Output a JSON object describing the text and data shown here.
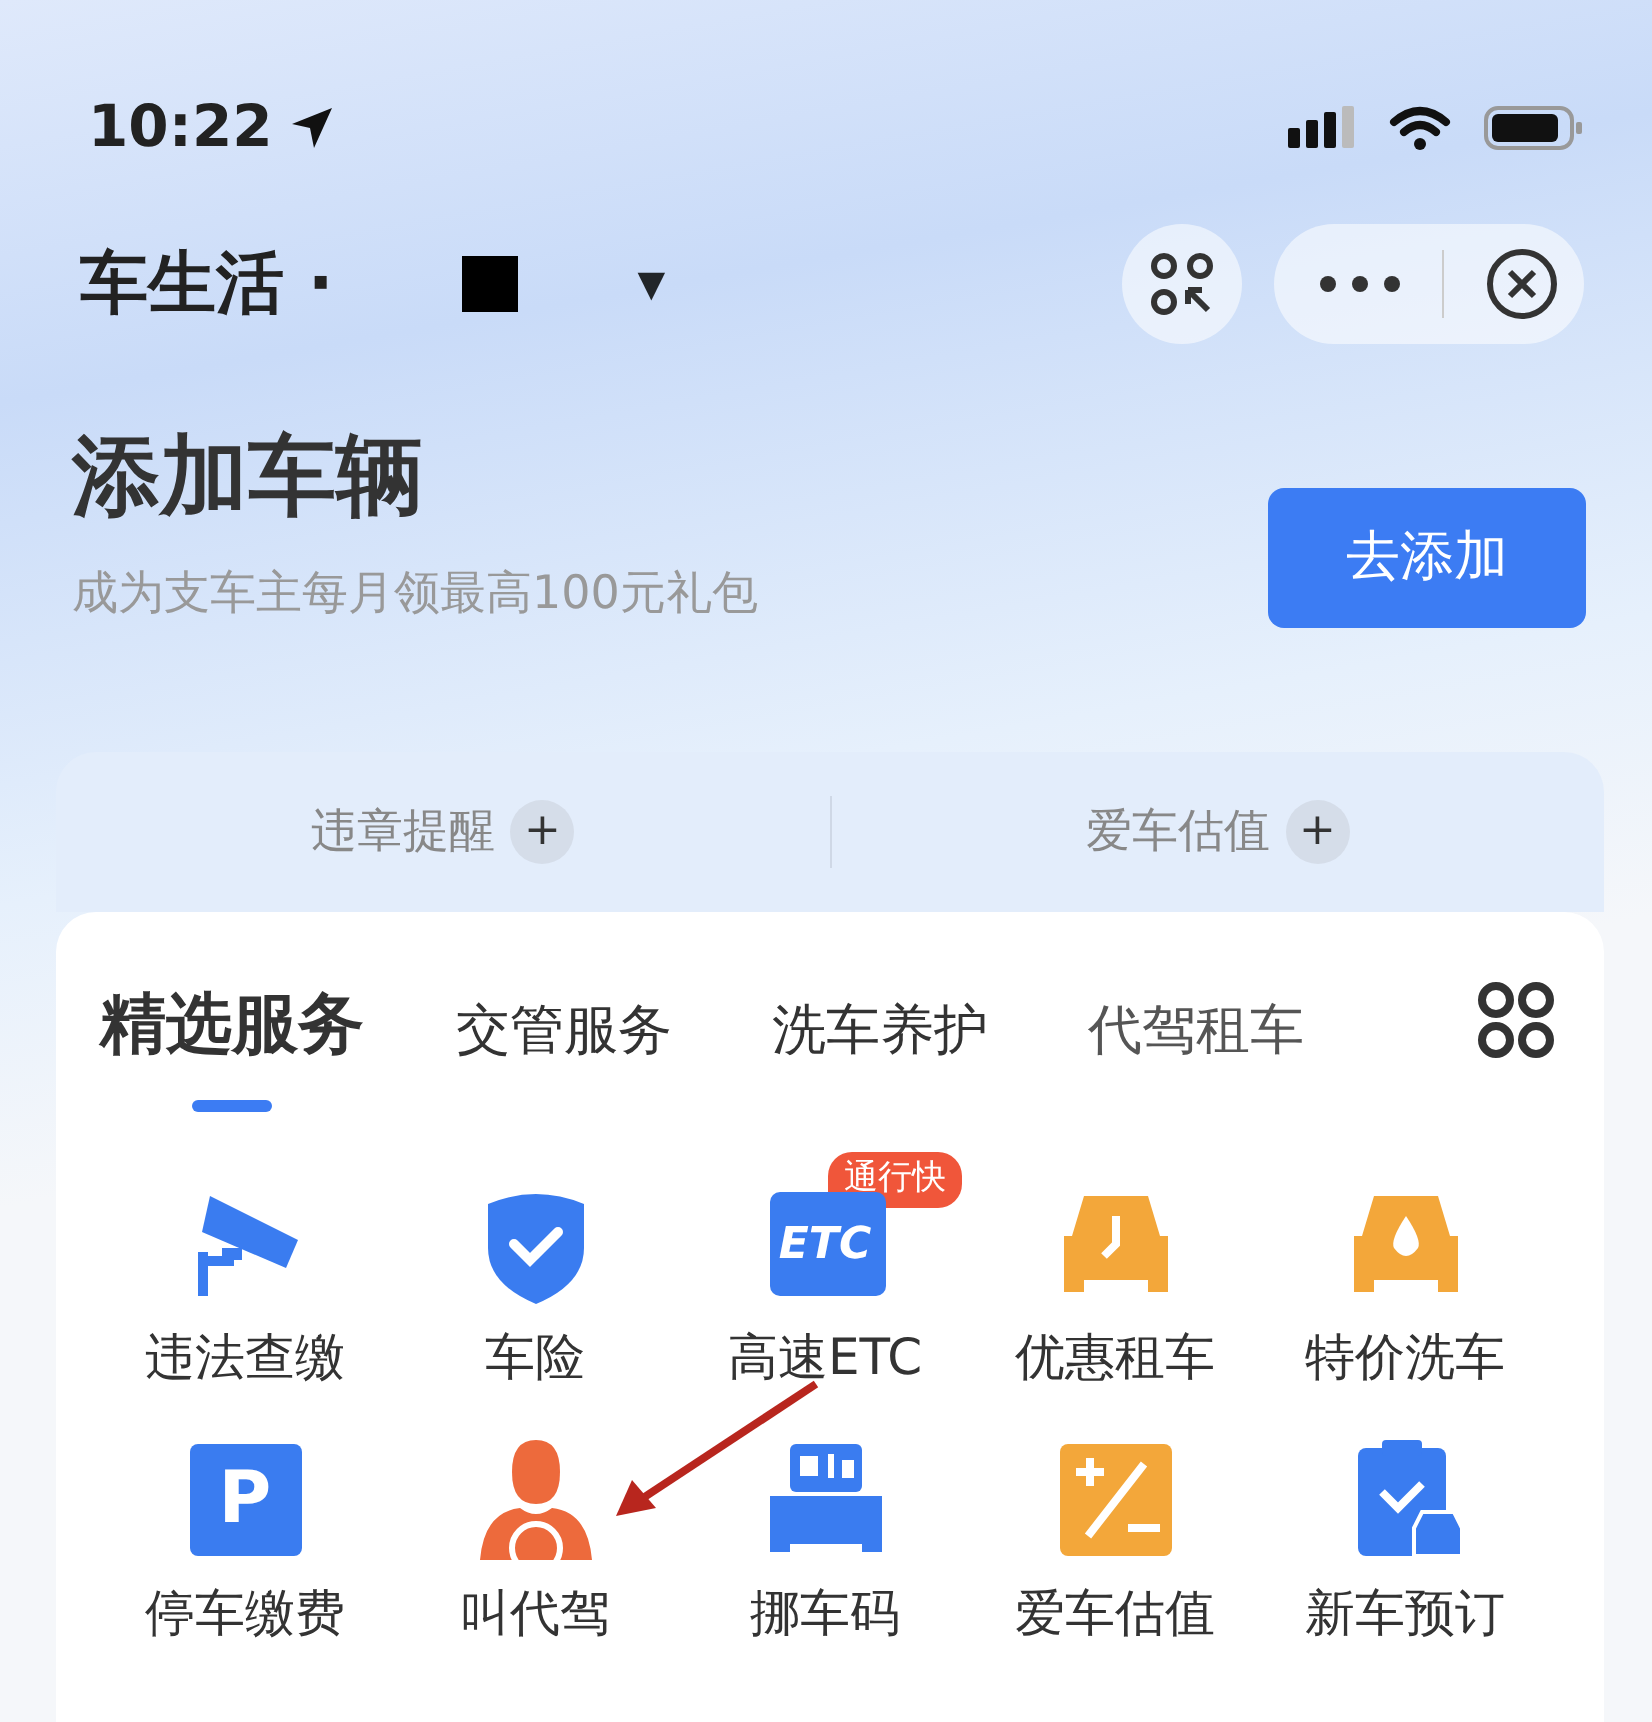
{
  "status_bar": {
    "time": "10:22"
  },
  "header": {
    "title": "车生活 ·",
    "dropdown_caret": "▼"
  },
  "hero": {
    "title": "添加车辆",
    "subtitle": "成为支车主每月领最高100元礼包",
    "button": "去添加"
  },
  "quick_links": [
    {
      "label": "违章提醒",
      "plus": "+"
    },
    {
      "label": "爱车估值",
      "plus": "+"
    }
  ],
  "tabs": [
    {
      "label": "精选服务",
      "selected": true
    },
    {
      "label": "交管服务",
      "selected": false
    },
    {
      "label": "洗车养护",
      "selected": false
    },
    {
      "label": "代驾租车",
      "selected": false
    }
  ],
  "services": [
    {
      "label": "违法查缴"
    },
    {
      "label": "车险"
    },
    {
      "label": "高速ETC",
      "icon_text": "ETC",
      "badge": "通行快"
    },
    {
      "label": "优惠租车"
    },
    {
      "label": "特价洗车"
    },
    {
      "label": "停车缴费",
      "icon_text": "P"
    },
    {
      "label": "叫代驾"
    },
    {
      "label": "挪车码"
    },
    {
      "label": "爱车估值"
    },
    {
      "label": "新车预订"
    }
  ]
}
